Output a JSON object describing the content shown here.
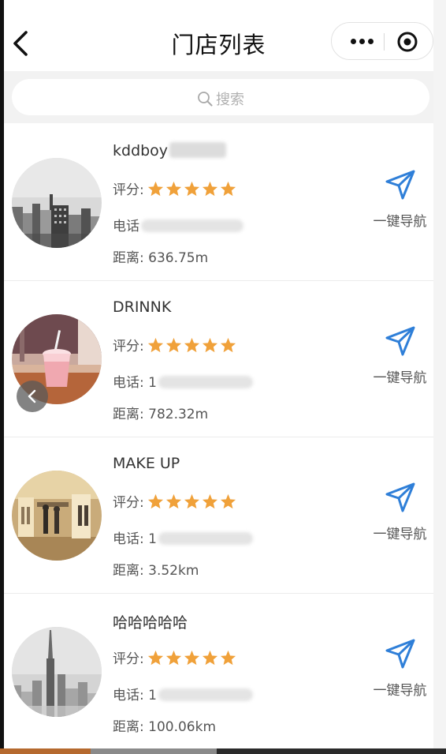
{
  "nav": {
    "title": "门店列表"
  },
  "search": {
    "placeholder": "搜索"
  },
  "labels": {
    "rating": "评分:",
    "phone": "电话:",
    "distance": "距离:",
    "navigate": "一键导航"
  },
  "stores": [
    {
      "name": "kddboy",
      "phone_visible": "",
      "distance": "636.75m",
      "rating": 5,
      "image": "city-skyline-gray"
    },
    {
      "name": "DRINNK",
      "phone_visible": "1",
      "distance": "782.32m",
      "rating": 5,
      "image": "pink-drink"
    },
    {
      "name": "MAKE UP",
      "phone_visible": "1",
      "distance": "3.52km",
      "rating": 5,
      "image": "boutique-interior"
    },
    {
      "name": "哈哈哈哈哈",
      "phone_visible": "1",
      "distance": "100.06km",
      "rating": 5,
      "image": "foggy-tower-city"
    }
  ],
  "colors": {
    "star": "#f0a13a",
    "navigate_icon": "#2f7fd8",
    "text": "#333333",
    "muted_text": "#555555",
    "search_bg": "#f2f2f2"
  },
  "icons": {
    "back": "back-arrow-icon",
    "more": "more-dots-icon",
    "close": "target-circle-icon",
    "search": "search-icon",
    "star": "star-icon",
    "navigate": "send-arrow-icon"
  }
}
